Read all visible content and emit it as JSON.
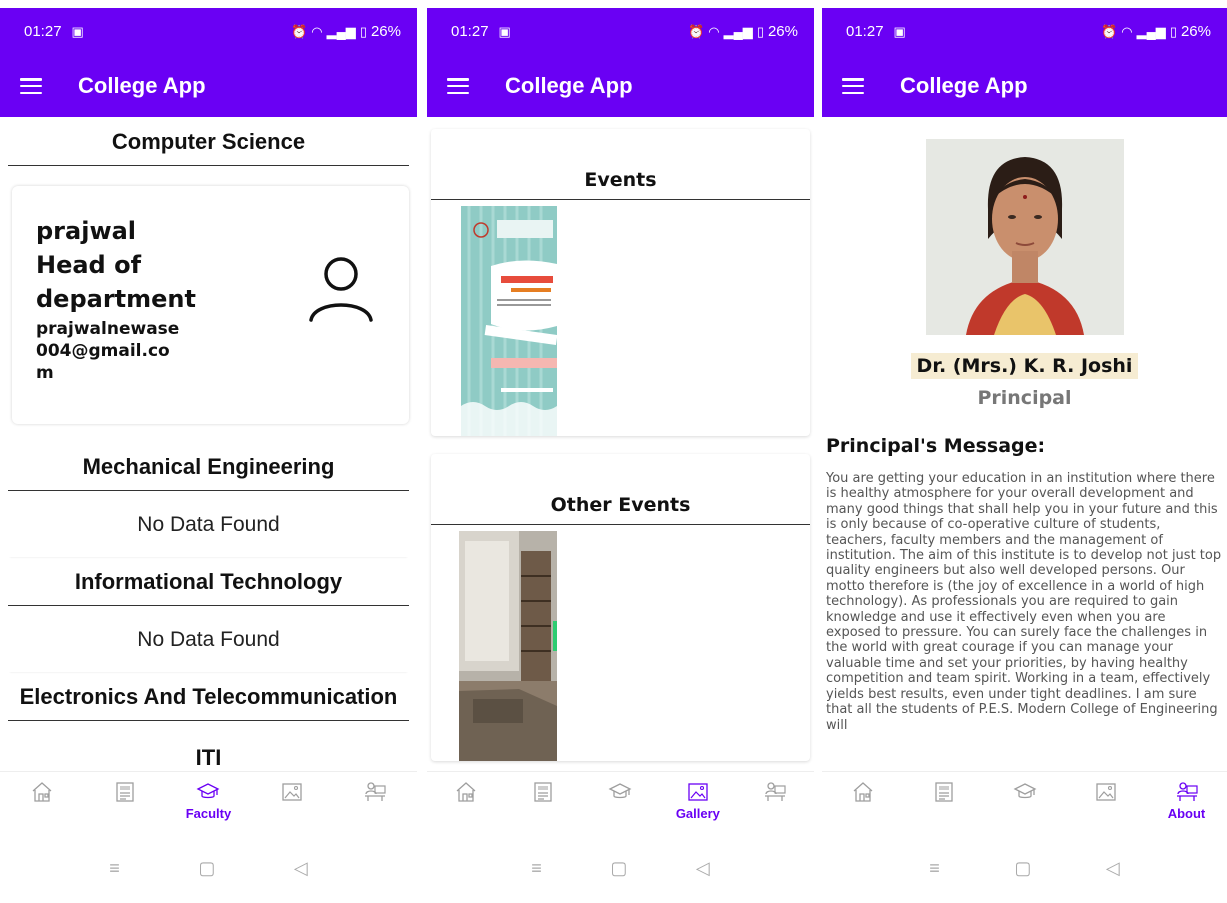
{
  "status": {
    "time": "01:27",
    "battery": "26%"
  },
  "app": {
    "title": "College App"
  },
  "faculty_screen": {
    "departments": [
      {
        "title": "Computer Science"
      },
      {
        "title": "Mechanical Engineering"
      },
      {
        "title": "Informational Technology"
      },
      {
        "title": "Electronics And Telecommunication"
      },
      {
        "title": "ITI"
      }
    ],
    "card": {
      "name": "prajwal",
      "role": "Head of department",
      "email": "prajwalnewase004@gmail.com"
    },
    "no_data": "No Data Found"
  },
  "gallery_screen": {
    "sections": [
      {
        "title": "Events"
      },
      {
        "title": "Other Events"
      }
    ]
  },
  "about_screen": {
    "name": "Dr. (Mrs.) K. R. Joshi",
    "role": "Principal",
    "message_title": "Principal's Message:",
    "message": "You are getting your education in an institution where there is healthy atmosphere for your overall development and many good things that shall help you in your future and this is only because of co-operative culture of students, teachers, faculty members and the management of institution.  The aim of this institute is to develop not just top quality engineers but also well developed persons. Our motto therefore is (the joy of excellence in a world of high technology).  As professionals you are required to gain knowledge and use it effectively even when you are exposed to pressure. You can surely face the challenges in the world with great courage if you can manage your valuable time and set your priorities, by having healthy competition and team spirit. Working in a team, effectively yields best results, even under tight deadlines.  I am sure that all the students of P.E.S. Modern College of Engineering will"
  },
  "bottom_nav": {
    "faculty_label": "Faculty",
    "gallery_label": "Gallery",
    "about_label": "About"
  },
  "icons": [
    "home-icon",
    "news-icon",
    "faculty-icon",
    "gallery-icon",
    "about-icon",
    "user-icon",
    "menu-icon",
    "alarm-icon",
    "wifi-icon",
    "signal-icon",
    "battery-icon"
  ],
  "colors": {
    "primary": "#6a00f4",
    "inactive_icon": "#9e9e9e"
  }
}
